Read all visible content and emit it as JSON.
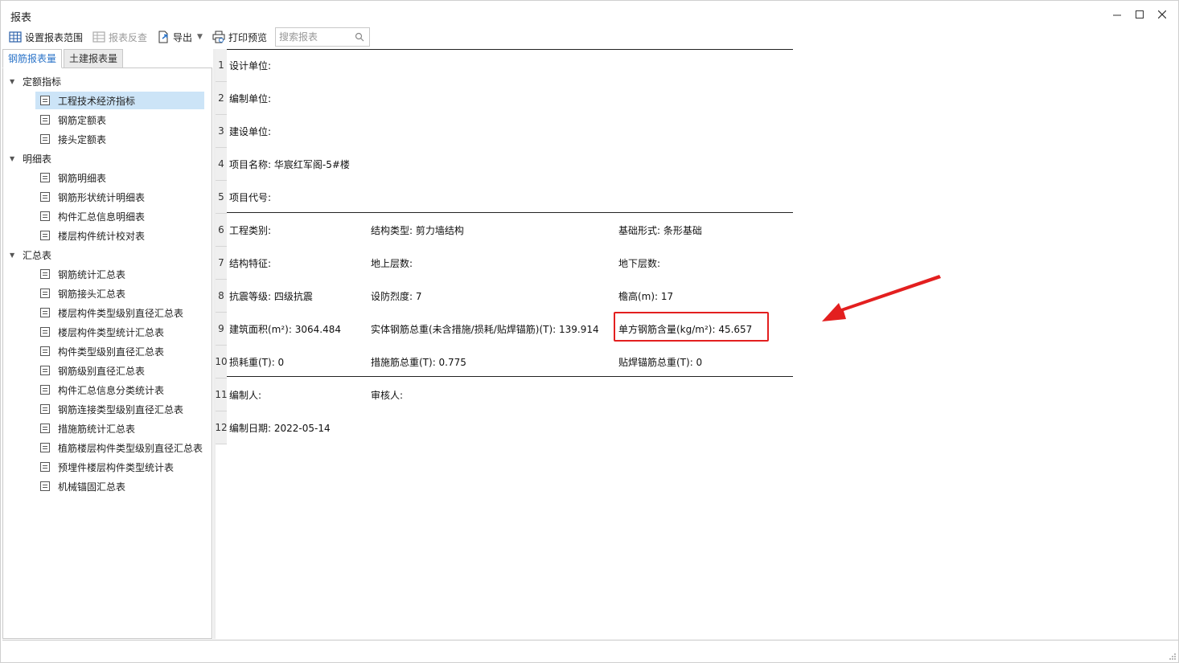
{
  "window": {
    "title": "报表",
    "controls": [
      "minimize",
      "maximize",
      "close"
    ]
  },
  "toolbar": {
    "set_range_label": "设置报表范围",
    "reverse_label": "报表反查",
    "export_label": "导出",
    "print_preview_label": "打印预览",
    "search_placeholder": "搜索报表"
  },
  "tabs": [
    {
      "label": "钢筋报表量",
      "active": true
    },
    {
      "label": "土建报表量",
      "active": false
    }
  ],
  "tree": {
    "groups": [
      {
        "label": "定额指标",
        "items": [
          "工程技术经济指标",
          "钢筋定额表",
          "接头定额表"
        ]
      },
      {
        "label": "明细表",
        "items": [
          "钢筋明细表",
          "钢筋形状统计明细表",
          "构件汇总信息明细表",
          "楼层构件统计校对表"
        ]
      },
      {
        "label": "汇总表",
        "items": [
          "钢筋统计汇总表",
          "钢筋接头汇总表",
          "楼层构件类型级别直径汇总表",
          "楼层构件类型统计汇总表",
          "构件类型级别直径汇总表",
          "钢筋级别直径汇总表",
          "构件汇总信息分类统计表",
          "钢筋连接类型级别直径汇总表",
          "措施筋统计汇总表",
          "植筋楼层构件类型级别直径汇总表",
          "预埋件楼层构件类型统计表",
          "机械锚固汇总表"
        ]
      }
    ],
    "selected": "工程技术经济指标"
  },
  "report": {
    "row_numbers": [
      "1",
      "2",
      "3",
      "4",
      "5",
      "6",
      "7",
      "8",
      "9",
      "10",
      "11",
      "12"
    ],
    "rows": {
      "design_unit": "设计单位:",
      "compile_unit": "编制单位:",
      "build_unit": "建设单位:",
      "project_name": "项目名称: 华宸红军阁-5#楼",
      "project_code": "项目代号:",
      "project_type": "工程类别:",
      "structure_type": "结构类型: 剪力墙结构",
      "foundation_type": "基础形式: 条形基础",
      "structure_feature": "结构特征:",
      "above_floors": "地上层数:",
      "below_floors": "地下层数:",
      "seismic_grade": "抗震等级: 四级抗震",
      "fortification_intensity": "设防烈度: 7",
      "eave_height": "檐高(m): 17",
      "building_area": "建筑面积(m²): 3064.484",
      "solid_rebar_weight": "实体钢筋总重(未含措施/损耗/贴焊锚筋)(T): 139.914",
      "rebar_per_sqm": "单方钢筋含量(kg/m²): 45.657",
      "loss_weight": "损耗重(T): 0",
      "measure_rebar_weight": "措施筋总重(T): 0.775",
      "weld_anchor_weight": "贴焊锚筋总重(T): 0",
      "compiler": "编制人:",
      "reviewer": "审核人:",
      "compile_date": "编制日期: 2022-05-14"
    }
  },
  "annotation": {
    "box_color": "#e31f1f",
    "arrow_color": "#e31f1f"
  }
}
